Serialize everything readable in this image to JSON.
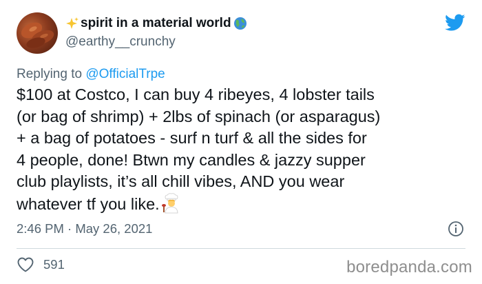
{
  "author": {
    "display_name": "spirit in a material world",
    "handle": "@earthy__crunchy",
    "avatar_icon": "avatar-food-photo",
    "name_prefix_icon": "sparkles-icon",
    "name_suffix_icon": "globe-icon"
  },
  "reply": {
    "prefix": "Replying to ",
    "mention": "@OfficialTrpe"
  },
  "body": {
    "lines": [
      "$100 at Costco, I can buy 4 ribeyes, 4 lobster tails",
      "(or bag of shrimp) + 2lbs of spinach (or asparagus)",
      "+ a bag of potatoes - surf n turf & all the sides for",
      "4 people, done! Btwn my candles & jazzy supper",
      "club playlists, it’s all chill vibes, AND you wear",
      "whatever tf you like."
    ],
    "trailing_emoji": "cook-emoji"
  },
  "meta": {
    "timestamp": "2:46 PM · May 26, 2021"
  },
  "stats": {
    "likes": "591"
  },
  "watermark": "boredpanda.com",
  "colors": {
    "twitter_blue": "#1d9bf0",
    "muted_text": "#536471",
    "main_text": "#0f1419",
    "divider": "#cfd9de"
  }
}
